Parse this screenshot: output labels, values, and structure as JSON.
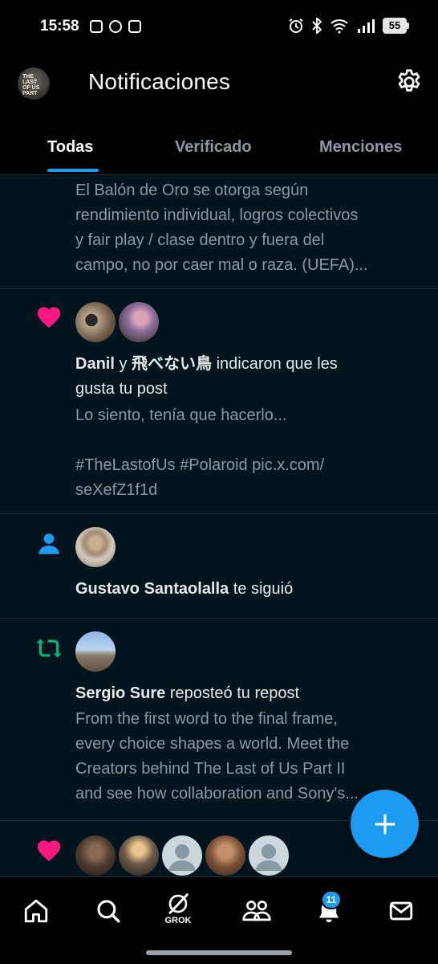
{
  "status_bar": {
    "time": "15:58",
    "app_icons": [
      "instagram-icon",
      "pinterest-icon",
      "twitch-icon"
    ],
    "system_icons": [
      "alarm-icon",
      "bluetooth-icon",
      "wifi-icon",
      "signal-icon"
    ],
    "battery": "55"
  },
  "header": {
    "title": "Notificaciones",
    "avatar_text": "THE LAST OF US PART II"
  },
  "tabs": [
    {
      "label": "Todas",
      "active": true
    },
    {
      "label": "Verificado",
      "active": false
    },
    {
      "label": "Menciones",
      "active": false
    }
  ],
  "notifications": [
    {
      "type": "partial",
      "lines": [
        "El Balón de Oro se otorga según",
        "rendimiento individual, logros colectivos",
        "y fair play / clase dentro y fuera del",
        "campo, no por caer mal o raza. (UEFA)..."
      ]
    },
    {
      "type": "like",
      "icon": "heart-icon",
      "user1": "Danil",
      "connector": "y",
      "user2": "飛べない鳥",
      "action": "indicaron que les",
      "action_line2": "gusta tu post",
      "preview_lines": [
        "Lo siento, tenía que hacerlo...",
        "",
        "#TheLastofUs #Polaroid pic.x.com/",
        "seXefZ1f1d"
      ]
    },
    {
      "type": "follow",
      "icon": "person-icon",
      "user": "Gustavo Santaolalla",
      "action": "te siguió"
    },
    {
      "type": "repost",
      "icon": "repost-icon",
      "user": "Sergio Sure",
      "action": "reposteó tu repost",
      "preview_lines": [
        "From the first word to the final frame,",
        "every choice shapes a world. Meet the",
        "Creators behind The Last of Us Part II",
        "and see how collaboration and Sony's..."
      ]
    },
    {
      "type": "like",
      "icon": "heart-icon"
    }
  ],
  "bottom_nav": {
    "items": [
      "home-icon",
      "search-icon",
      "grok-icon",
      "communities-icon",
      "notifications-icon",
      "messages-icon"
    ],
    "grok_label": "GROK",
    "notification_count": "11"
  },
  "colors": {
    "accent": "#1d9bf0",
    "like": "#f91880",
    "repost": "#00ba7c",
    "background": "#02141d",
    "secondary_text": "#8b98a5"
  }
}
